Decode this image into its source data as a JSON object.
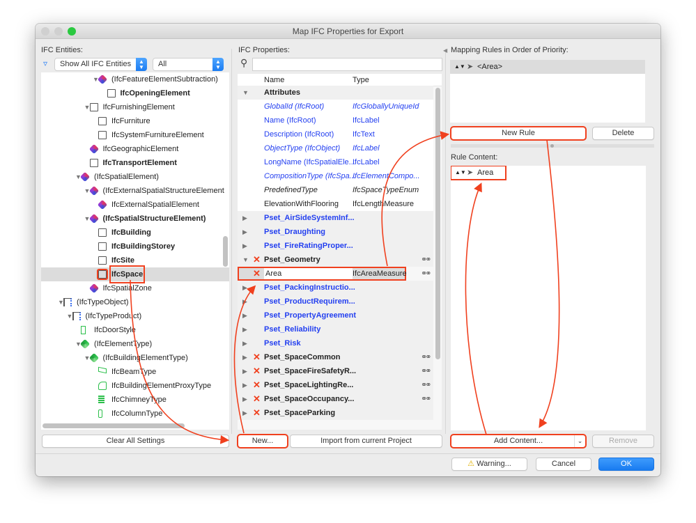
{
  "window": {
    "title": "Map IFC Properties for Export"
  },
  "entities": {
    "label": "IFC Entities:",
    "filter_select": "Show All IFC Entities",
    "scope_select": "All",
    "tree": [
      {
        "text": "(IfcFeatureElementSubtraction)",
        "depth": 6,
        "expanded": true,
        "icon": "ifc-logo-icon",
        "bold": false
      },
      {
        "text": "IfcOpeningElement",
        "depth": 7,
        "icon": "opening-icon",
        "bold": true
      },
      {
        "text": "IfcFurnishingElement",
        "depth": 5,
        "expanded": true,
        "icon": "chair-icon",
        "bold": false
      },
      {
        "text": "IfcFurniture",
        "depth": 6,
        "icon": "chair-icon",
        "bold": false
      },
      {
        "text": "IfcSystemFurnitureElement",
        "depth": 6,
        "icon": "chair-icon",
        "bold": false
      },
      {
        "text": "IfcGeographicElement",
        "depth": 5,
        "icon": "ifc-logo-icon",
        "bold": false
      },
      {
        "text": "IfcTransportElement",
        "depth": 5,
        "icon": "elevator-icon",
        "bold": true
      },
      {
        "text": "(IfcSpatialElement)",
        "depth": 4,
        "expanded": true,
        "icon": "ifc-logo-icon",
        "bold": false
      },
      {
        "text": "(IfcExternalSpatialStructureElement",
        "depth": 5,
        "expanded": true,
        "icon": "ifc-logo-icon",
        "bold": false
      },
      {
        "text": "IfcExternalSpatialElement",
        "depth": 6,
        "icon": "ifc-logo-icon",
        "bold": false
      },
      {
        "text": "(IfcSpatialStructureElement)",
        "depth": 5,
        "expanded": true,
        "icon": "ifc-logo-icon",
        "bold": true
      },
      {
        "text": "IfcBuilding",
        "depth": 6,
        "icon": "building-icon",
        "bold": true
      },
      {
        "text": "IfcBuildingStorey",
        "depth": 6,
        "icon": "storey-icon",
        "bold": true
      },
      {
        "text": "IfcSite",
        "depth": 6,
        "icon": "site-icon",
        "bold": true
      },
      {
        "text": "IfcSpace",
        "depth": 6,
        "icon": "space-icon",
        "bold": true,
        "selected": true
      },
      {
        "text": "IfcSpatialZone",
        "depth": 5,
        "icon": "ifc-logo-icon",
        "bold": false
      },
      {
        "text": "(IfcTypeObject)",
        "depth": 2,
        "expanded": true,
        "icon": "type-object-icon",
        "bold": false
      },
      {
        "text": "(IfcTypeProduct)",
        "depth": 3,
        "expanded": true,
        "icon": "type-object-icon",
        "bold": false
      },
      {
        "text": "IfcDoorStyle",
        "depth": 4,
        "icon": "door-icon",
        "bold": false
      },
      {
        "text": "(IfcElementType)",
        "depth": 4,
        "expanded": true,
        "icon": "ifc-green-logo-icon",
        "bold": false
      },
      {
        "text": "(IfcBuildingElementType)",
        "depth": 5,
        "expanded": true,
        "icon": "ifc-green-logo-icon",
        "bold": false
      },
      {
        "text": "IfcBeamType",
        "depth": 6,
        "icon": "beam-icon",
        "bold": false
      },
      {
        "text": "IfcBuildingElementProxyType",
        "depth": 6,
        "icon": "proxy-icon",
        "bold": false
      },
      {
        "text": "IfcChimneyType",
        "depth": 6,
        "icon": "chimney-icon",
        "bold": false
      },
      {
        "text": "IfcColumnType",
        "depth": 6,
        "icon": "column-icon",
        "bold": false
      }
    ],
    "clear_button": "Clear All Settings"
  },
  "properties": {
    "label": "IFC Properties:",
    "search_value": "",
    "columns": {
      "name": "Name",
      "type": "Type"
    },
    "rows": [
      {
        "kind": "group",
        "name": "Attributes",
        "expanded": true,
        "style": "black"
      },
      {
        "kind": "prop",
        "name": "GlobalId (IfcRoot)",
        "type": "IfcGloballyUniqueId",
        "style": "blue-italic"
      },
      {
        "kind": "prop",
        "name": "Name (IfcRoot)",
        "type": "IfcLabel",
        "style": "blue"
      },
      {
        "kind": "prop",
        "name": "Description (IfcRoot)",
        "type": "IfcText",
        "style": "blue"
      },
      {
        "kind": "prop",
        "name": "ObjectType (IfcObject)",
        "type": "IfcLabel",
        "style": "blue-italic"
      },
      {
        "kind": "prop",
        "name": "LongName (IfcSpatialEle...",
        "type": "IfcLabel",
        "style": "blue"
      },
      {
        "kind": "prop",
        "name": "CompositionType (IfcSpa...",
        "type": "IfcElementCompo...",
        "style": "blue-italic"
      },
      {
        "kind": "prop",
        "name": "PredefinedType",
        "type": "IfcSpaceTypeEnum",
        "style": "black-italic"
      },
      {
        "kind": "prop",
        "name": "ElevationWithFlooring",
        "type": "IfcLengthMeasure",
        "style": "black"
      },
      {
        "kind": "group",
        "name": "Pset_AirSideSystemInf...",
        "style": "blue"
      },
      {
        "kind": "group",
        "name": "Pset_Draughting",
        "style": "blue"
      },
      {
        "kind": "group",
        "name": "Pset_FireRatingProper...",
        "style": "blue"
      },
      {
        "kind": "group",
        "name": "Pset_Geometry",
        "expanded": true,
        "style": "black",
        "custom": true,
        "linked": true
      },
      {
        "kind": "edit",
        "name": "Area",
        "type": "IfcAreaMeasure",
        "style": "black",
        "custom": true,
        "linked": true,
        "selected": true
      },
      {
        "kind": "group",
        "name": "Pset_PackingInstructio...",
        "style": "blue"
      },
      {
        "kind": "group",
        "name": "Pset_ProductRequirem...",
        "style": "blue"
      },
      {
        "kind": "group",
        "name": "Pset_PropertyAgreement",
        "style": "blue"
      },
      {
        "kind": "group",
        "name": "Pset_Reliability",
        "style": "blue"
      },
      {
        "kind": "group",
        "name": "Pset_Risk",
        "style": "blue"
      },
      {
        "kind": "group",
        "name": "Pset_SpaceCommon",
        "style": "black",
        "custom": true,
        "linked": true
      },
      {
        "kind": "group",
        "name": "Pset_SpaceFireSafetyR...",
        "style": "black",
        "custom": true,
        "linked": true
      },
      {
        "kind": "group",
        "name": "Pset_SpaceLightingRe...",
        "style": "black",
        "custom": true,
        "linked": true
      },
      {
        "kind": "group",
        "name": "Pset_SpaceOccupancy...",
        "style": "black",
        "custom": true,
        "linked": true
      },
      {
        "kind": "group",
        "name": "Pset_SpaceParking",
        "style": "black",
        "custom": true
      }
    ],
    "new_button": "New...",
    "import_button": "Import from current Project"
  },
  "rules": {
    "label": "Mapping Rules in Order of Priority:",
    "items": [
      "<Area>"
    ],
    "new_rule_button": "New Rule",
    "delete_button": "Delete",
    "content_label": "Rule Content:",
    "content_items": [
      "Area"
    ],
    "add_content_button": "Add Content...",
    "remove_button": "Remove"
  },
  "footer": {
    "warning_button": "Warning...",
    "cancel_button": "Cancel",
    "ok_button": "OK"
  },
  "colors": {
    "accent": "#1a7cf0",
    "annotation": "#f0401e",
    "link_blue": "#2440f0"
  }
}
